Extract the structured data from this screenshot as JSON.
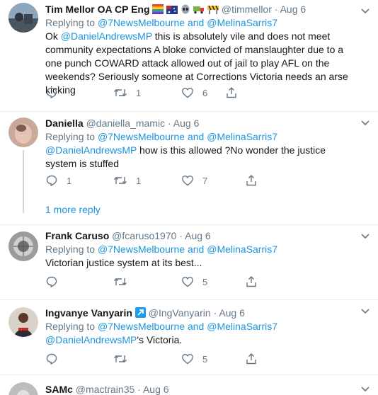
{
  "tweets": [
    {
      "display_name": "Tim Mellor OA CP Eng",
      "handle": "@timmellor",
      "dot": "·",
      "time": "Aug 6",
      "replying_prefix": "Replying to ",
      "replying_a": "@7NewsMelbourne",
      "replying_and": " and ",
      "replying_b": "@MelinaSarris7",
      "mention": "@DanielAndrewsMP",
      "text_before": "Ok ",
      "text_after": " this is absolutely vile and does not meet community expectations A bloke convicted of manslaughter due to a one punch COWARD attack allowed out of jail to play AFL on the weekends? Seriously someone at Corrections Victoria needs an arse kicking",
      "reply_count": "",
      "retweet_count": "1",
      "like_count": "6"
    },
    {
      "display_name": "Daniella",
      "handle": "@daniella_mamic",
      "dot": "·",
      "time": "Aug 6",
      "replying_prefix": "Replying to ",
      "replying_a": "@7NewsMelbourne",
      "replying_and": " and ",
      "replying_b": "@MelinaSarris7",
      "mention": "@DanielAndrewsMP",
      "text_after": " how is this allowed ?No wonder the justice system is stuffed",
      "reply_count": "1",
      "retweet_count": "1",
      "like_count": "7"
    },
    {
      "display_name": "Frank Caruso",
      "handle": "@fcaruso1970",
      "dot": "·",
      "time": "Aug 6",
      "replying_prefix": "Replying to ",
      "replying_a": "@7NewsMelbourne",
      "replying_and": " and ",
      "replying_b": "@MelinaSarris7",
      "text": "Victorian justice system at its best...",
      "reply_count": "",
      "retweet_count": "",
      "like_count": "5"
    },
    {
      "display_name": "Ingvanye Vanyarin",
      "handle": "@IngVanyarin",
      "dot": "·",
      "time": "Aug 6",
      "replying_prefix": "Replying to ",
      "replying_a": "@7NewsMelbourne",
      "replying_and": " and ",
      "replying_b": "@MelinaSarris7",
      "mention": "@DanielAndrewsMP",
      "text_after": "'s Victoria.",
      "reply_count": "",
      "retweet_count": "",
      "like_count": "5"
    },
    {
      "display_name": "SAMc",
      "handle": "@mactrain35",
      "dot": "·",
      "time": "Aug 6"
    }
  ],
  "more_replies": "1 more reply",
  "colors": {
    "link": "#1b95e0",
    "muted": "#657786",
    "text": "#14171a",
    "divider": "#e6ecf0"
  },
  "icons": [
    "chevron-down-icon",
    "reply-icon",
    "retweet-icon",
    "like-icon",
    "share-icon",
    "arrow-badge-icon"
  ]
}
